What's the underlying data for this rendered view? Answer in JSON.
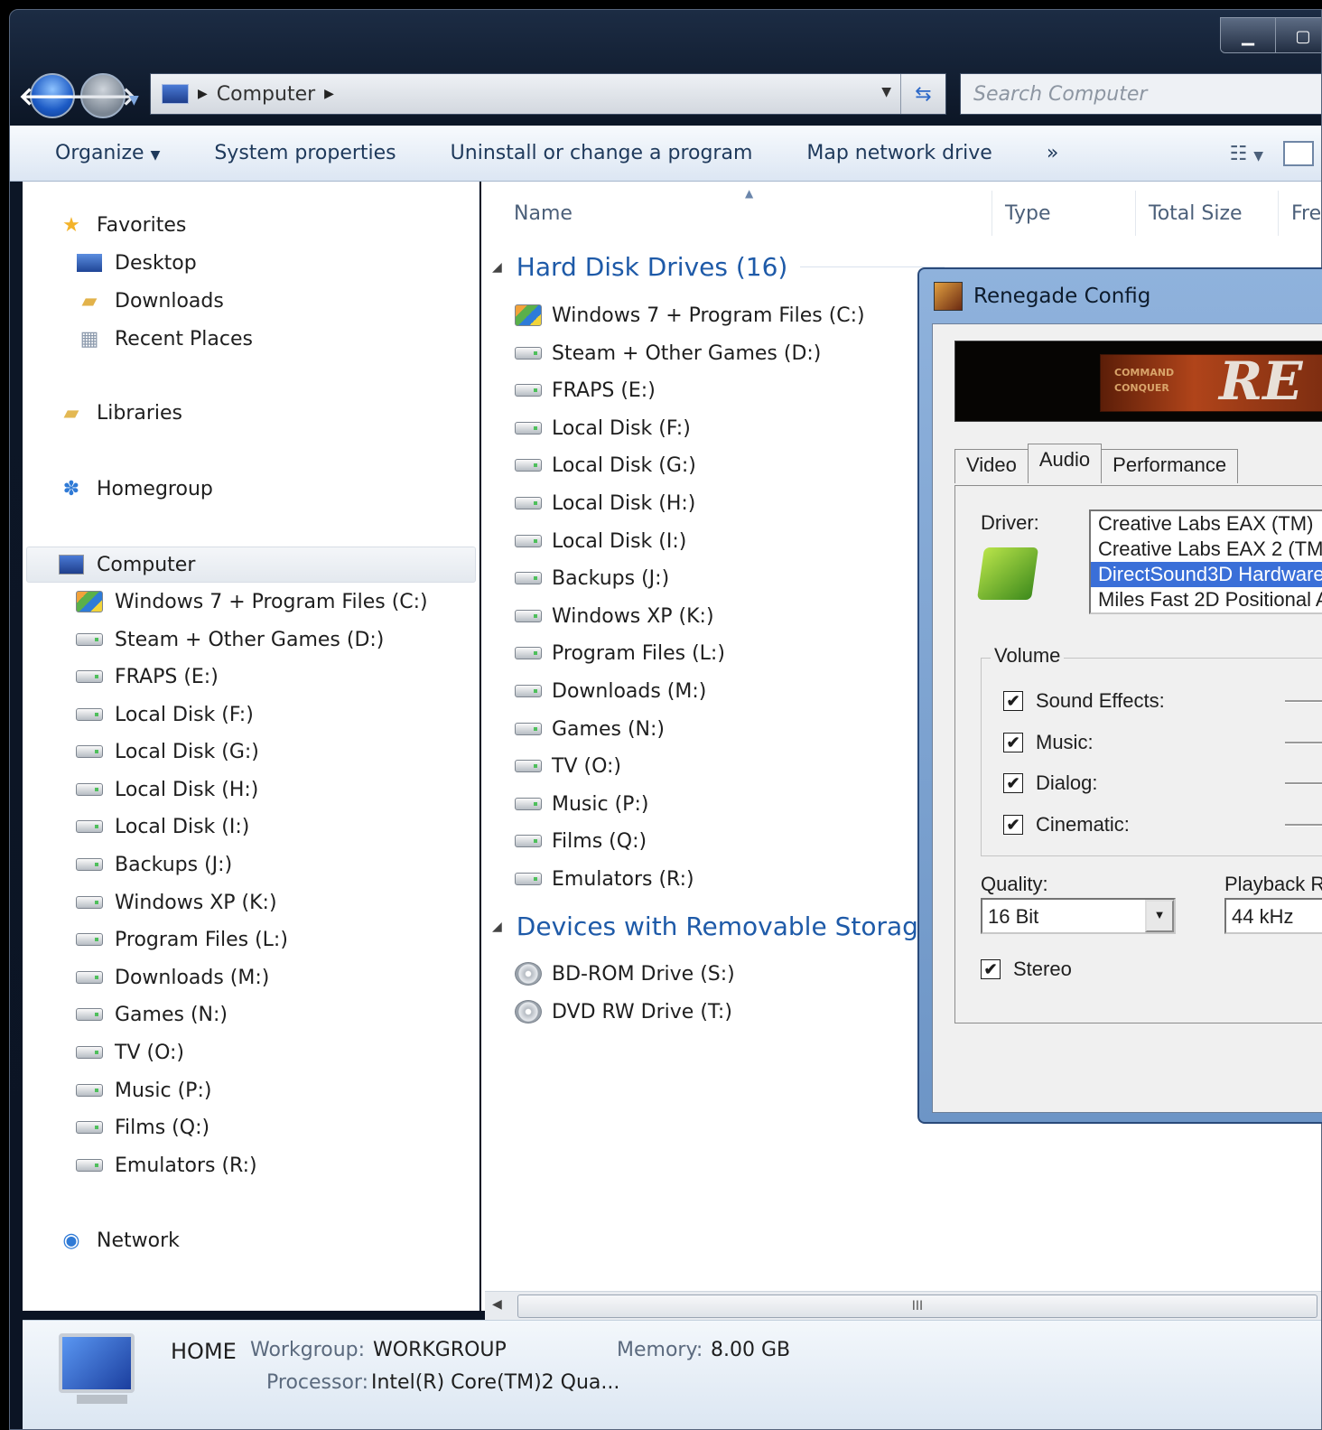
{
  "window": {
    "caption_buttons": [
      "minimize",
      "maximize"
    ]
  },
  "addressbar": {
    "crumbs": [
      "Computer"
    ],
    "search_placeholder": "Search Computer"
  },
  "toolbar": {
    "organize": "Organize",
    "system_properties": "System properties",
    "uninstall": "Uninstall or change a program",
    "map_network": "Map network drive",
    "more": "»"
  },
  "nav": {
    "favorites": "Favorites",
    "favorites_items": [
      "Desktop",
      "Downloads",
      "Recent Places"
    ],
    "libraries": "Libraries",
    "homegroup": "Homegroup",
    "computer": "Computer",
    "drives": [
      "Windows 7 + Program Files (C:)",
      "Steam + Other Games (D:)",
      "FRAPS (E:)",
      "Local Disk (F:)",
      "Local Disk (G:)",
      "Local Disk (H:)",
      "Local Disk (I:)",
      "Backups (J:)",
      "Windows XP (K:)",
      "Program Files (L:)",
      "Downloads (M:)",
      "Games (N:)",
      "TV (O:)",
      "Music (P:)",
      "Films (Q:)",
      "Emulators (R:)"
    ],
    "network": "Network"
  },
  "columns": {
    "name": "Name",
    "type": "Type",
    "total_size": "Total Size",
    "free": "Fre"
  },
  "content": {
    "hdd_group": "Hard Disk Drives (16)",
    "hdd": [
      "Windows 7 + Program Files (C:)",
      "Steam + Other Games (D:)",
      "FRAPS (E:)",
      "Local Disk (F:)",
      "Local Disk (G:)",
      "Local Disk (H:)",
      "Local Disk (I:)",
      "Backups (J:)",
      "Windows XP (K:)",
      "Program Files (L:)",
      "Downloads (M:)",
      "Games (N:)",
      "TV (O:)",
      "Music (P:)",
      "Films (Q:)",
      "Emulators (R:)"
    ],
    "removable_group": "Devices with Removable Storage",
    "removable": [
      "BD-ROM Drive (S:)",
      "DVD RW Drive (T:)"
    ]
  },
  "details": {
    "name": "HOME",
    "workgroup_label": "Workgroup:",
    "workgroup": "WORKGROUP",
    "memory_label": "Memory:",
    "memory": "8.00 GB",
    "processor_label": "Processor:",
    "processor": "Intel(R) Core(TM)2 Qua..."
  },
  "dialog": {
    "title": "Renegade Config",
    "banner_line1": "COMMAND",
    "banner_line2": "CONQUER",
    "banner_word": "RE",
    "tabs": [
      "Video",
      "Audio",
      "Performance"
    ],
    "driver_label": "Driver:",
    "drivers": [
      "Creative Labs EAX (TM)",
      "Creative Labs EAX 2 (TM",
      "DirectSound3D Hardware",
      "Miles Fast 2D Positional A"
    ],
    "selected_driver_index": 2,
    "volume_label": "Volume",
    "volume_items": [
      {
        "label": "Sound Effects:",
        "checked": true
      },
      {
        "label": "Music:",
        "checked": true
      },
      {
        "label": "Dialog:",
        "checked": true
      },
      {
        "label": "Cinematic:",
        "checked": true
      }
    ],
    "quality_label": "Quality:",
    "quality_value": "16 Bit",
    "playback_label": "Playback R",
    "playback_value": "44 kHz",
    "stereo_label": "Stereo",
    "stereo_checked": true,
    "check_mark": "✔"
  }
}
